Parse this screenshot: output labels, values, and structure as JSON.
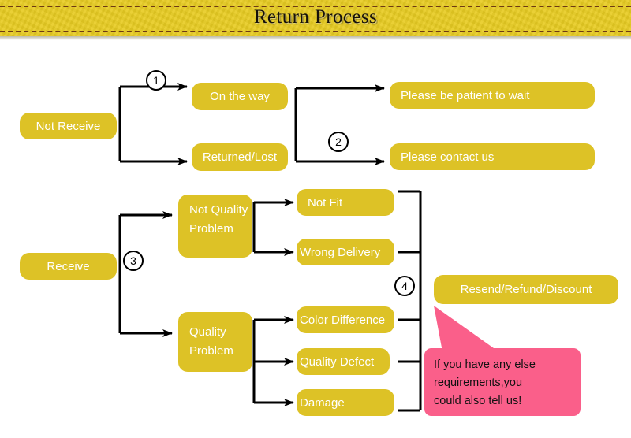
{
  "header": {
    "title": "Return Process",
    "banner_color": "#e8cc22",
    "stitch_color": "#6e3a12"
  },
  "theme": {
    "node_color": "#ddc226",
    "node_text_color": "#ffffff",
    "line_color": "#000000",
    "callout_color": "#fa5f8a",
    "callout_text_color": "#111111",
    "page_background": "#ffffff"
  },
  "flow": {
    "roots": [
      {
        "id": "not-receive",
        "label": "Not Receive"
      },
      {
        "id": "receive",
        "label": "Receive"
      }
    ],
    "branches": [
      {
        "id": "on-the-way",
        "label": "On the way"
      },
      {
        "id": "returned-lost",
        "label": "Returned/Lost"
      },
      {
        "id": "not-quality-problem",
        "label": "Not\nQuality\nProblem"
      },
      {
        "id": "quality-problem",
        "label": "Quality\nProblem"
      }
    ],
    "leaves": [
      {
        "id": "not-fit",
        "label": "Not Fit"
      },
      {
        "id": "wrong-delivery",
        "label": "Wrong Delivery"
      },
      {
        "id": "color-difference",
        "label": "Color Difference"
      },
      {
        "id": "quality-defect",
        "label": "Quality Defect"
      },
      {
        "id": "damage",
        "label": "Damage"
      }
    ],
    "outcomes": [
      {
        "id": "be-patient",
        "label": "Please be patient to wait"
      },
      {
        "id": "contact-us",
        "label": "Please contact us"
      },
      {
        "id": "resend-refund-discount",
        "label": "Resend/Refund/Discount"
      }
    ],
    "markers": [
      {
        "id": "marker-1",
        "label": "1"
      },
      {
        "id": "marker-2",
        "label": "2"
      },
      {
        "id": "marker-3",
        "label": "3"
      },
      {
        "id": "marker-4",
        "label": "4"
      }
    ]
  },
  "callout": {
    "line1": "If you have any else",
    "line2": "requirements,you",
    "line3": "could also tell us!"
  }
}
